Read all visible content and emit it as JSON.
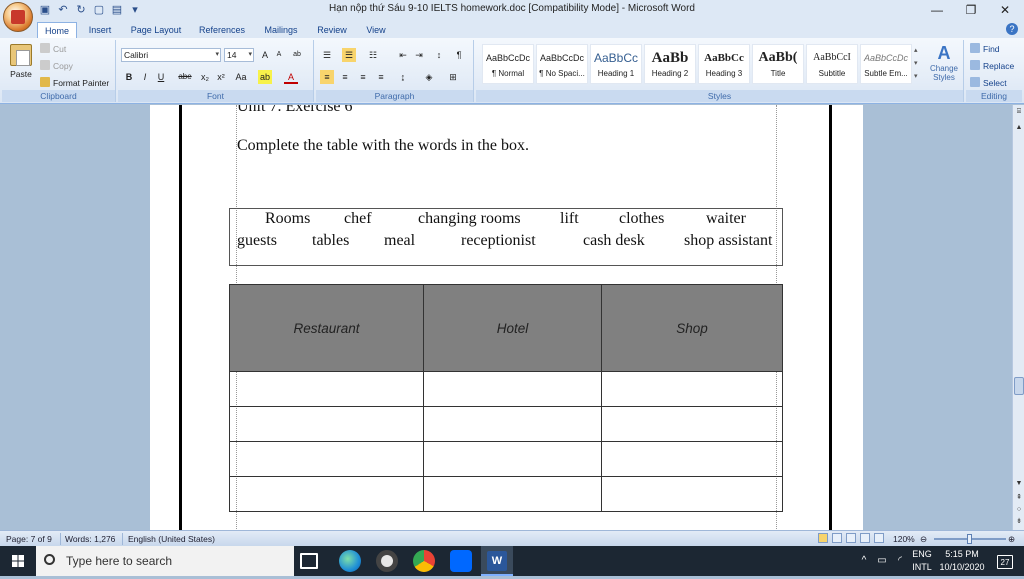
{
  "window": {
    "title": "Hạn nộp thứ Sáu 9-10 IELTS homework.doc [Compatibility Mode] - Microsoft Word",
    "minimize": "—",
    "restore": "❐",
    "close": "✕"
  },
  "quick_access": [
    "save-icon",
    "undo-icon",
    "redo-icon",
    "new-icon",
    "open-icon",
    "customize-icon"
  ],
  "tabs": [
    {
      "label": "Home",
      "active": true
    },
    {
      "label": "Insert"
    },
    {
      "label": "Page Layout"
    },
    {
      "label": "References"
    },
    {
      "label": "Mailings"
    },
    {
      "label": "Review"
    },
    {
      "label": "View"
    }
  ],
  "clipboard": {
    "paste": "Paste",
    "cut": "Cut",
    "copy": "Copy",
    "format_painter": "Format Painter",
    "label": "Clipboard"
  },
  "font": {
    "name": "Calibri",
    "size": "14",
    "grow": "A",
    "shrink": "A",
    "clear": "ab",
    "bold": "B",
    "italic": "I",
    "underline": "U",
    "strike": "abe",
    "subscript": "x₂",
    "superscript": "x²",
    "case": "Aa",
    "highlight": "ab",
    "color": "A",
    "label": "Font"
  },
  "paragraph": {
    "label": "Paragraph"
  },
  "styles": {
    "label": "Styles",
    "items": [
      {
        "sample": "AaBbCcDc",
        "name": "¶ Normal"
      },
      {
        "sample": "AaBbCcDc",
        "name": "¶ No Spaci..."
      },
      {
        "sample": "AaBbCc",
        "name": "Heading 1"
      },
      {
        "sample": "AaBb",
        "name": "Heading 2"
      },
      {
        "sample": "AaBbCc",
        "name": "Heading 3"
      },
      {
        "sample": "AaBb(",
        "name": "Title"
      },
      {
        "sample": "AaBbCcI",
        "name": "Subtitle"
      },
      {
        "sample": "AaBbCcDc",
        "name": "Subtle Em..."
      }
    ],
    "change": "Change Styles"
  },
  "editing": {
    "find": "Find",
    "replace": "Replace",
    "select": "Select",
    "label": "Editing"
  },
  "document": {
    "heading_partial": "Unit 7. Exercise 6",
    "instruction": "Complete the table with the words in the box.",
    "word_row1": [
      "Rooms",
      "chef",
      "changing rooms",
      "lift",
      "clothes",
      "waiter"
    ],
    "word_row2": [
      "guests",
      "tables",
      "meal",
      "receptionist",
      "cash desk",
      "shop assistant"
    ],
    "table_headers": [
      "Restaurant",
      "Hotel",
      "Shop"
    ]
  },
  "status": {
    "page": "Page: 7 of 9",
    "words": "Words: 1,276",
    "language": "English (United States)",
    "zoom": "120%"
  },
  "taskbar": {
    "search_placeholder": "Type here to search",
    "lang1": "ENG",
    "lang2": "INTL",
    "time": "5:15 PM",
    "date": "10/10/2020",
    "notifications": "27"
  }
}
